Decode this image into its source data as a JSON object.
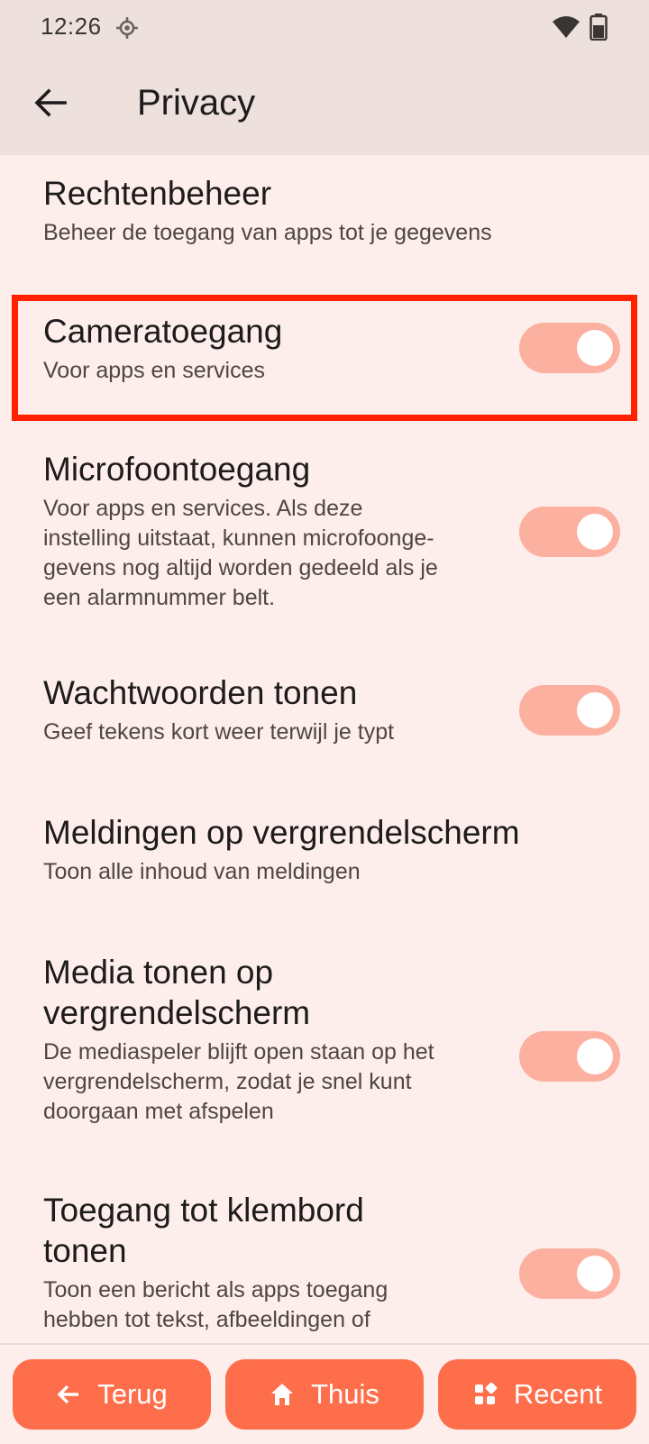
{
  "status_bar": {
    "time": "12:26",
    "icons": [
      "location-icon",
      "wifi-icon",
      "battery-icon"
    ]
  },
  "app_bar": {
    "back_icon": "arrow-left-icon",
    "title": "Privacy"
  },
  "items": [
    {
      "title": "Rechtenbeheer",
      "subtitle": "Beheer de toegang van apps tot je gegevens",
      "toggle": null
    },
    {
      "title": "Cameratoegang",
      "subtitle": "Voor apps en services",
      "toggle": true,
      "highlighted": true
    },
    {
      "title": "Microfoontoegang",
      "subtitle_lines": [
        "Voor apps en services. Als deze",
        "instelling uitstaat, kunnen microfoonge-",
        "gevens nog altijd worden gedeeld als je",
        "een alarmnummer belt."
      ],
      "toggle": true
    },
    {
      "title": "Wachtwoorden tonen",
      "subtitle": "Geef tekens kort weer terwijl je typt",
      "toggle": true
    },
    {
      "title": "Meldingen op vergrendelscherm",
      "subtitle": "Toon alle inhoud van meldingen",
      "toggle": null
    },
    {
      "title_lines": [
        "Media tonen op",
        "vergrendelscherm"
      ],
      "subtitle_lines": [
        "De mediaspeler blijft open staan op het",
        "vergrendelscherm, zodat je snel kunt",
        "doorgaan met afspelen"
      ],
      "toggle": true
    },
    {
      "title_lines": [
        "Toegang tot klembord",
        "tonen"
      ],
      "subtitle_lines": [
        "Toon een bericht als apps toegang",
        "hebben tot tekst, afbeeldingen of"
      ],
      "toggle": true
    }
  ],
  "nav": {
    "back": {
      "label": "Terug",
      "icon": "arrow-left-icon"
    },
    "home": {
      "label": "Thuis",
      "icon": "home-icon"
    },
    "recent": {
      "label": "Recent",
      "icon": "apps-icon"
    }
  },
  "colors": {
    "background": "#fdeeeb",
    "app_bar": "#ede0dd",
    "toggle_track": "#fbb0a0",
    "nav_button": "#ff6e4a",
    "highlight": "#ff2100"
  }
}
